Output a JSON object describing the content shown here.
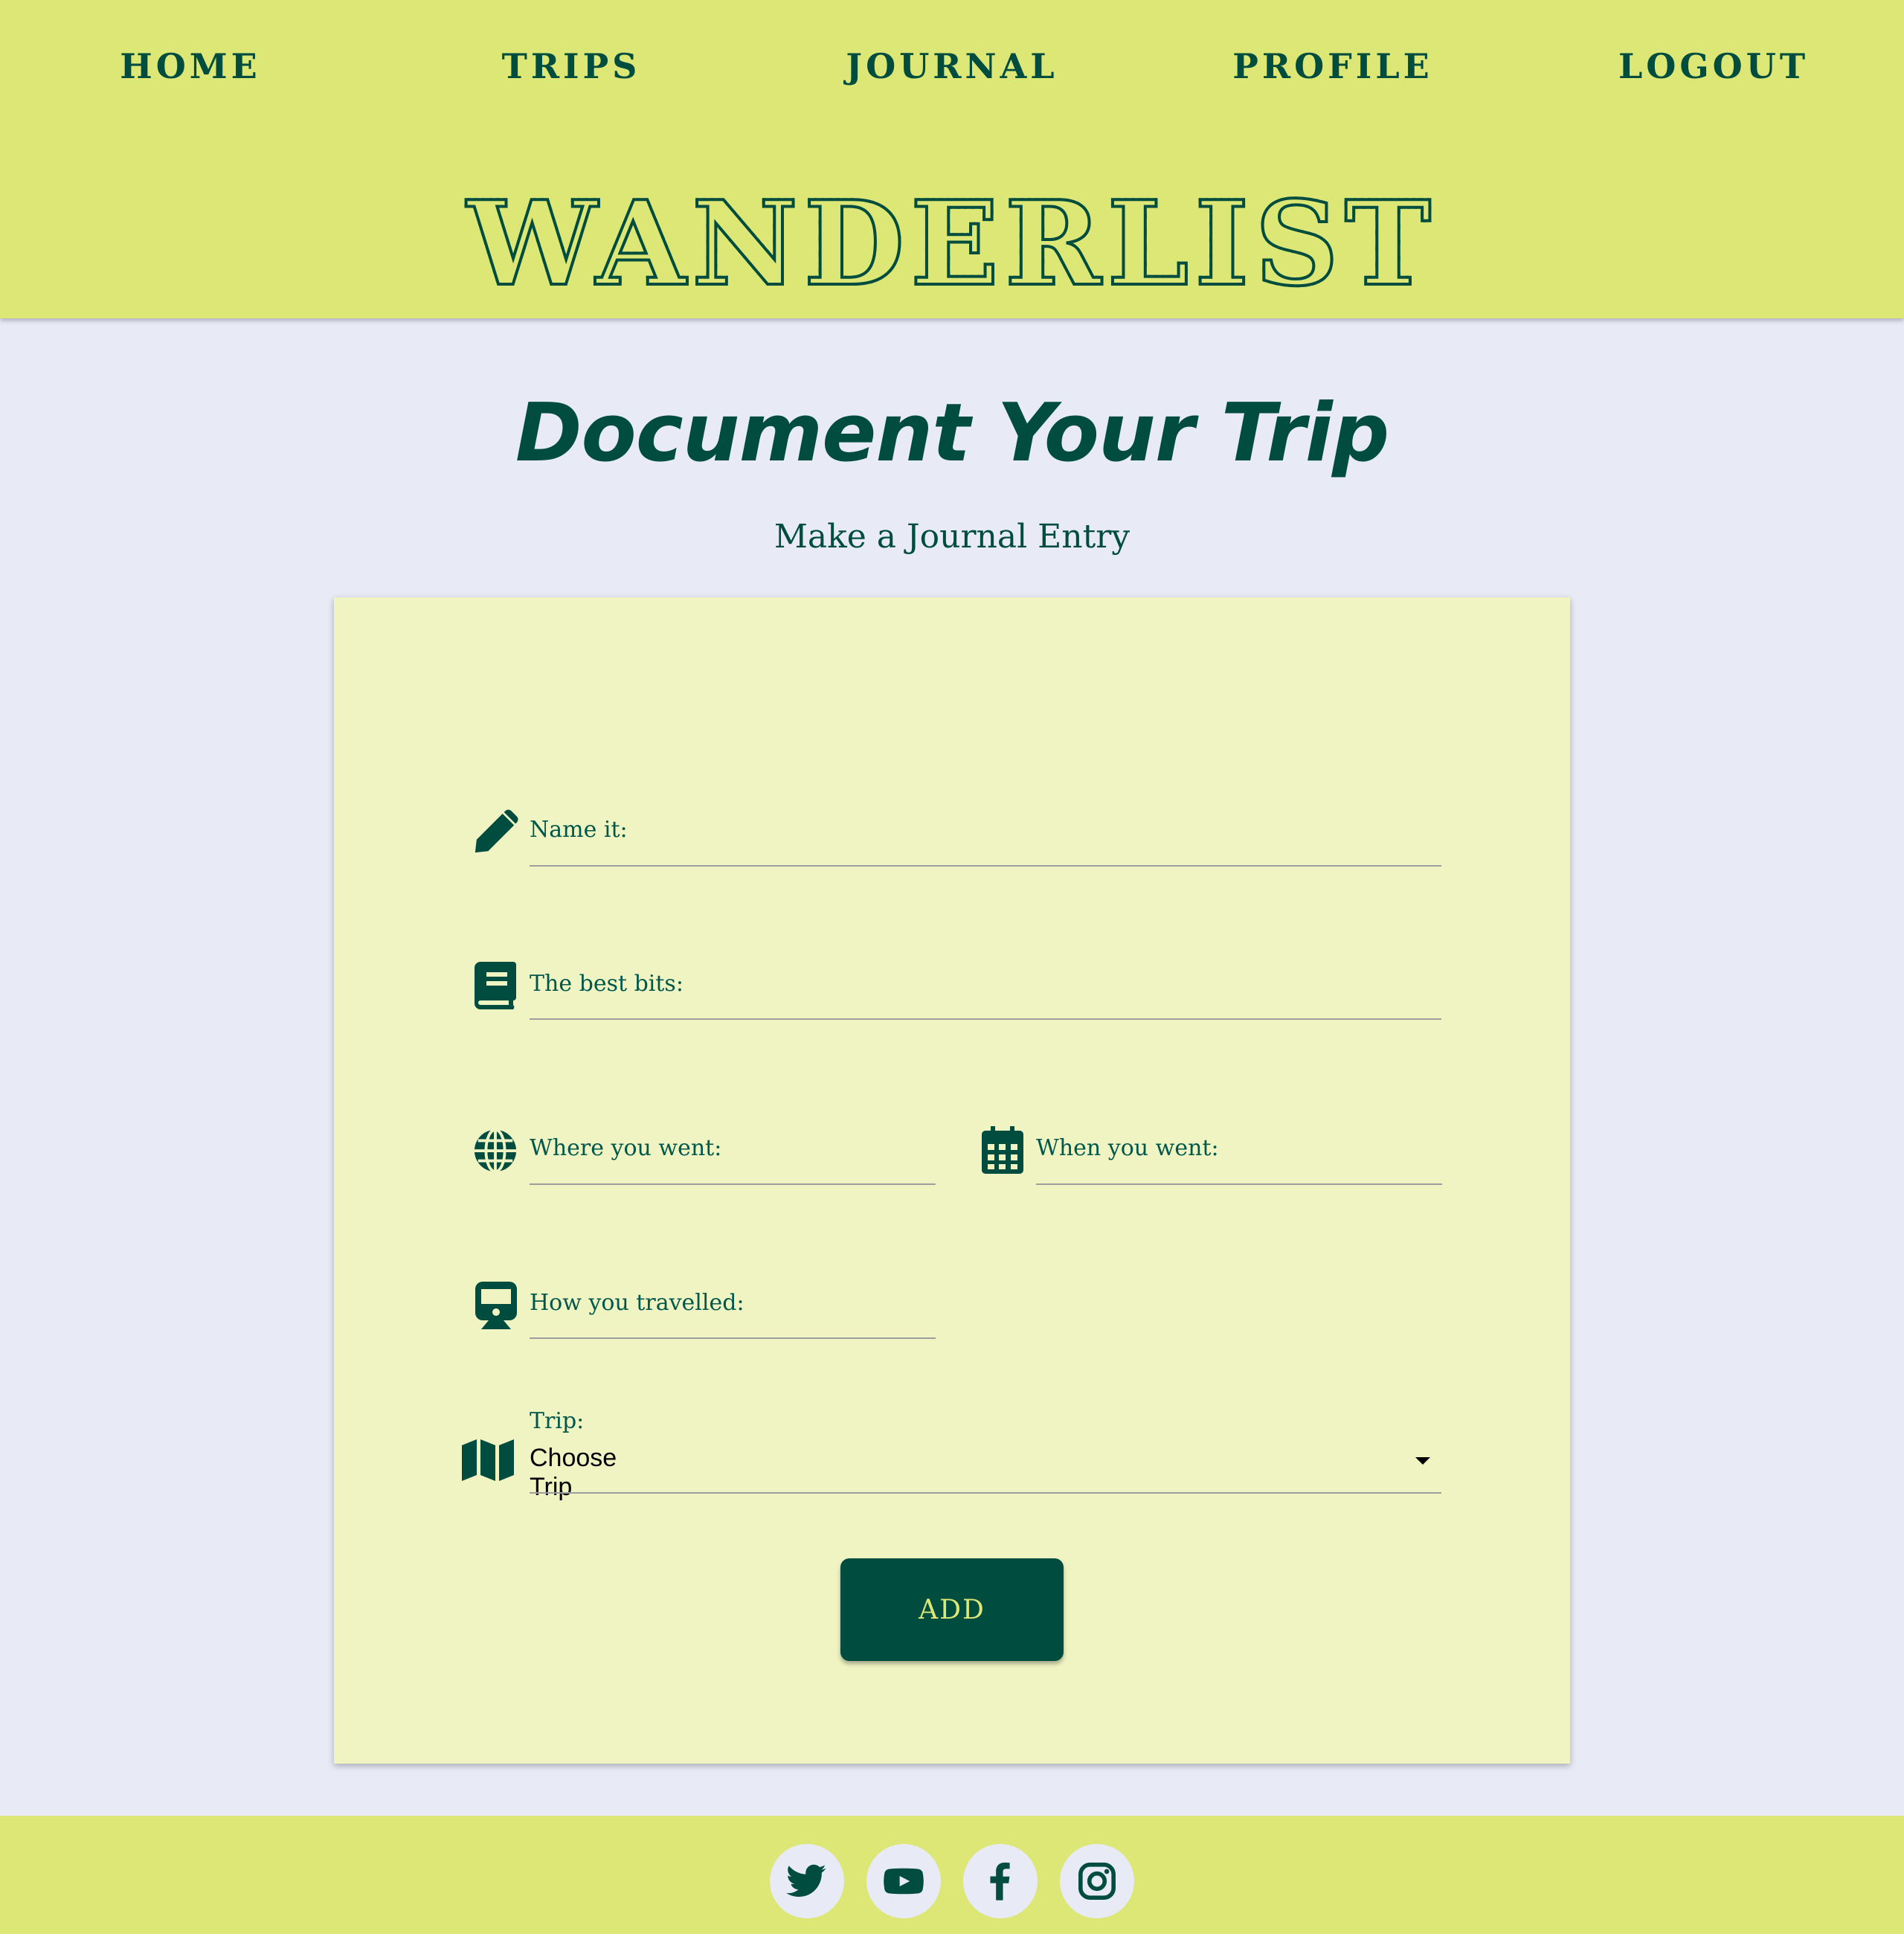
{
  "nav": {
    "items": [
      {
        "label": "HOME"
      },
      {
        "label": "TRIPS"
      },
      {
        "label": "JOURNAL"
      },
      {
        "label": "PROFILE"
      },
      {
        "label": "LOGOUT"
      }
    ]
  },
  "brand": {
    "title": "WANDERLIST"
  },
  "main": {
    "title": "Document Your Trip",
    "subtitle": "Make a Journal Entry"
  },
  "form": {
    "name": {
      "label": "Name it:",
      "icon": "pencil-icon"
    },
    "best_bits": {
      "label": "The best bits:",
      "icon": "book-icon"
    },
    "where": {
      "label": "Where you went:",
      "icon": "globe-icon"
    },
    "when": {
      "label": "When you went:",
      "icon": "calendar-icon"
    },
    "how": {
      "label": "How you travelled:",
      "icon": "train-icon"
    },
    "trip": {
      "label": "Trip:",
      "value": "Choose Trip",
      "icon": "map-icon"
    },
    "submit_label": "ADD"
  },
  "footer": {
    "social": [
      {
        "icon": "twitter-icon"
      },
      {
        "icon": "youtube-icon"
      },
      {
        "icon": "facebook-icon"
      },
      {
        "icon": "instagram-icon"
      }
    ]
  },
  "colors": {
    "primary": "#004d40",
    "accent": "#dce775",
    "card": "#f0f4c3",
    "background": "#e8eaf6"
  }
}
